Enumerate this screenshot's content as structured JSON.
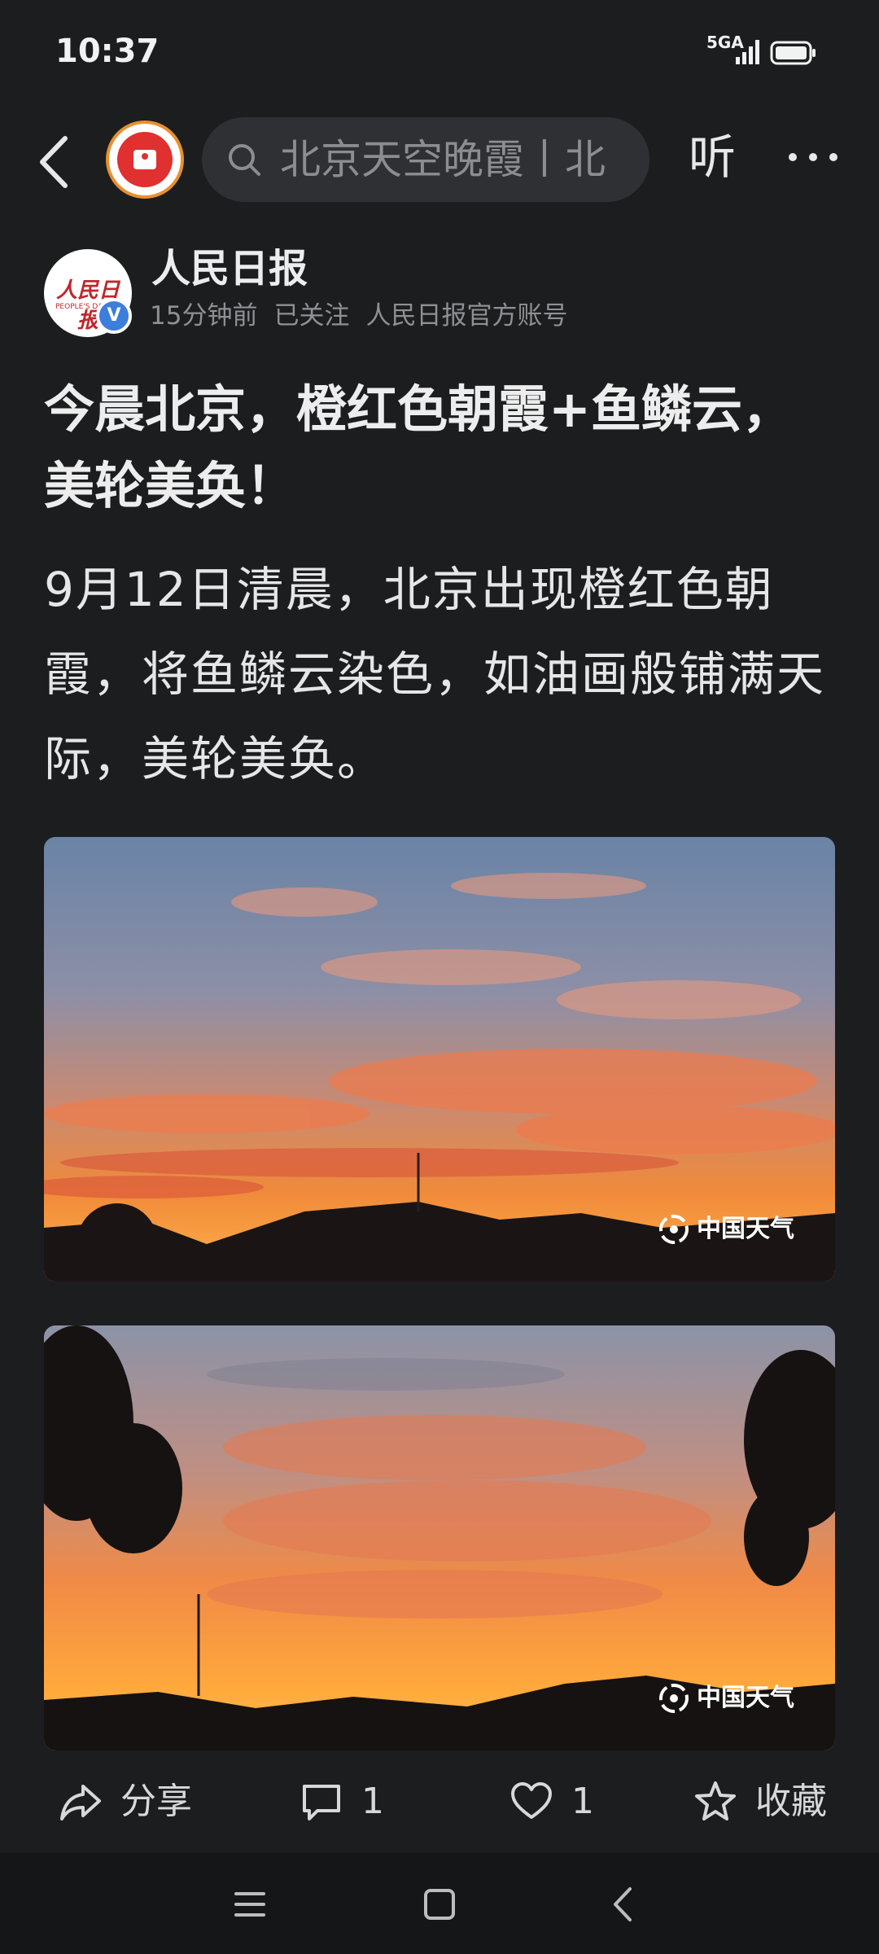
{
  "status_bar": {
    "time": "10:37",
    "network": "5GA"
  },
  "top_nav": {
    "search_text": "北京天空晚霞丨北",
    "listen_label": "听"
  },
  "author": {
    "avatar_text": "人民日报",
    "avatar_sub": "PEOPLE'S DAILY",
    "name": "人民日报",
    "time_ago": "15分钟前",
    "follow_status": "已关注",
    "account_type": "人民日报官方账号",
    "verified_badge": "V"
  },
  "article": {
    "title": "今晨北京，橙红色朝霞+鱼鳞云，美轮美奂！",
    "body": "9月12日清晨，北京出现橙红色朝霞，将鱼鳞云染色，如油画般铺满天际，美轮美奂。"
  },
  "photos": [
    {
      "watermark": "中国天气"
    },
    {
      "watermark": "中国天气"
    }
  ],
  "actions": {
    "share": "分享",
    "comment_count": "1",
    "like_count": "1",
    "favorite": "收藏"
  },
  "colors": {
    "background": "#1c1d1f",
    "search_bg": "#2e3033",
    "verified": "#3d7ddb",
    "brand_red": "#e03030"
  },
  "icons": [
    "back-icon",
    "app-logo-icon",
    "search-icon",
    "more-icon",
    "share-icon",
    "comment-icon",
    "heart-icon",
    "star-icon",
    "menu-icon",
    "home-icon",
    "nav-back-icon"
  ]
}
